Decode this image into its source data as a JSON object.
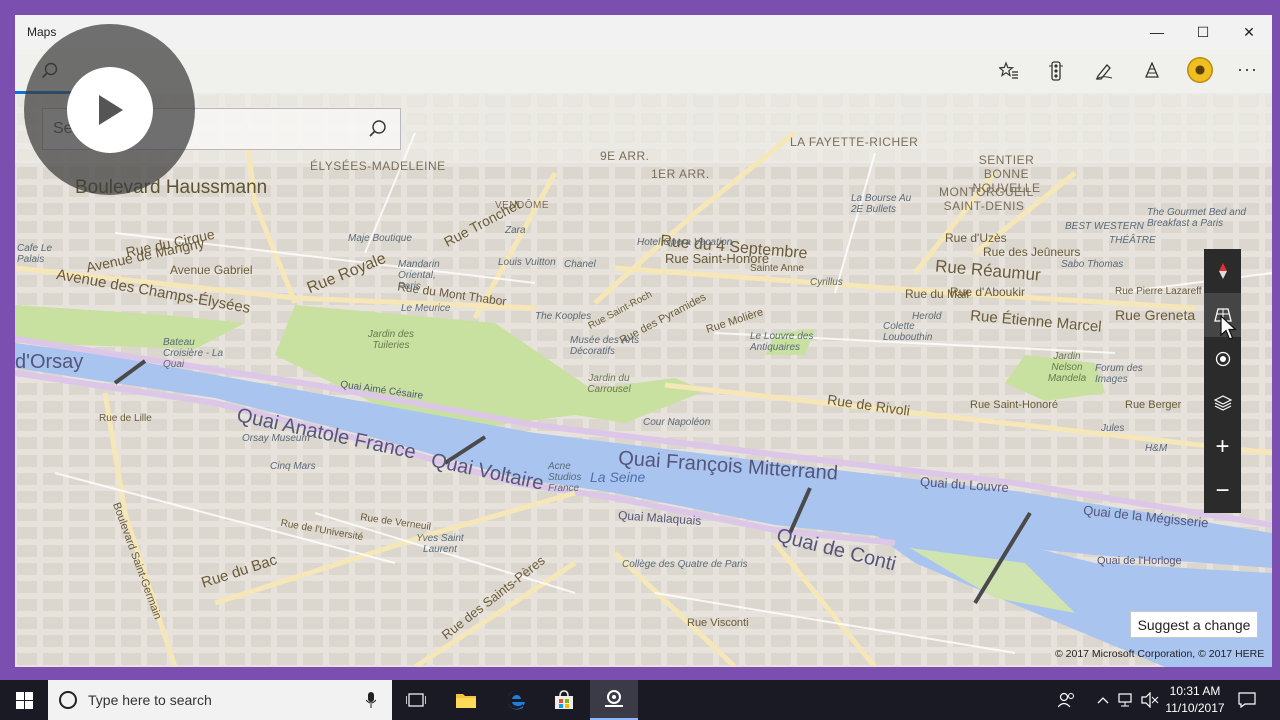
{
  "window": {
    "title": "Maps",
    "minimize": "—",
    "maximize": "☐",
    "close": "✕"
  },
  "search": {
    "placeholder": "Search"
  },
  "map": {
    "labels": {
      "haussmann": "Boulevard Haussmann",
      "elysees_madeleine": "ÉLYSÉES-MADELEINE",
      "arr9": "9E ARR.",
      "arr1": "1ER ARR.",
      "lafayette": "LA FAYETTE-RICHER",
      "sentier": "SENTIER BONNE NOUVELLE",
      "montorgueil": "MONTORGUEIL SAINT-DENIS",
      "vendome": "VENDÔME",
      "rue_du_cirque": "Rue du Cirque",
      "avenue_marigny": "Avenue de Marigny",
      "avenue_gabriel": "Avenue Gabriel",
      "champs": "Avenue des Champs-Élysées",
      "rue_royale": "Rue Royale",
      "rue_tronchet": "Rue Tronchet",
      "rue_4_sept": "Rue du 4 Septembre",
      "rue_st_honore": "Rue Saint-Honoré",
      "rue_st_honore_2": "Rue du Mont Thabor",
      "rue_reaumur": "Rue Réaumur",
      "rue_etienne": "Rue Étienne Marcel",
      "rue_grenata": "Rue Greneta",
      "rue_rivoli": "Rue de Rivoli",
      "rue_st_honore_3": "Rue Saint-Honoré",
      "rue_de_lille": "Rue de Lille",
      "rue_du_bac": "Rue du Bac",
      "rue_sts_peres": "Rue des Saints-Pères",
      "rue_visconti": "Rue Visconti",
      "rue_verneuil": "Rue de Verneuil",
      "rue_universite": "Rue de l'Université",
      "bd_st_germain": "Boulevard Saint-Germain",
      "rue_uzes": "Rue d'Uzès",
      "rue_jeuneurs": "Rue des Jeûneurs",
      "rue_mail": "Rue du Mail",
      "rue_aboukir": "Rue d'Aboukir",
      "rue_moliere": "Rue Molière",
      "rue_des_pyramides": "Rue des Pyramides",
      "rue_saint_roch": "Rue Saint-Roch",
      "quai_anatole": "Quai Anatole France",
      "quai_voltaire": "Quai Voltaire",
      "quai_mitterrand": "Quai François Mitterrand",
      "quai_conti": "Quai de Conti",
      "quai_louvre": "Quai du Louvre",
      "quai_megisserie": "Quai de la Mégisserie",
      "quai_malaquais": "Quai Malaquais",
      "quai_horloge": "Quai de l'Horloge",
      "quai_aime": "Quai Aimé Césaire",
      "quai_orsay": "d'Orsay",
      "la_seine": "La Seine",
      "jardin_tuileries": "Jardin des Tuileries",
      "jardin_carrousel": "Jardin du Carrousel",
      "cour_napoleon": "Cour Napoléon",
      "jardin_nelson": "Jardin Nelson Mandela",
      "orsay_museum": "Orsay Museum",
      "cinq_mars": "Cinq Mars",
      "yves_st_laurent": "Yves Saint Laurent",
      "acne": "Acne Studios France",
      "college": "Collège des Quatre de Paris",
      "bateau": "Bateau Croisière - La Quai",
      "kooples": "The Kooples",
      "arts_deco": "Musée des Arts Décoratifs",
      "louvre_antiquaires": "Le Louvre des Antiquaires",
      "forum_images": "Forum des Images",
      "sabo": "Sabo Thomas",
      "chanel": "Chanel",
      "vuitton": "Louis Vuitton",
      "zara": "Zara",
      "majestic": "Maje Boutique",
      "mandarin": "Mandarin Oriental, Paris",
      "le_meurice": "Le Meurice",
      "cyrillus": "Cyrillus",
      "colette": "Colette Loubouthin",
      "pierre_lazareff": "Rue Pierre Lazareff",
      "bourse": "La Bourse Au 2E Bullets",
      "gourmet": "The Gourmet Bed and Breakfast a Paris",
      "best_western": "BEST WESTERN",
      "theatre": "THÉÂTRE",
      "h_m": "H&M",
      "jules": "Jules",
      "rue_berger": "Rue Berger",
      "rue_sainte_anne": "Sainte Anne",
      "cafe_le_paris": "Cafe Le Palais",
      "le_quai": "La Quai",
      "hotel": "Hotel Opera Vacation",
      "herold": "Herold"
    }
  },
  "controls": {
    "compass": "compass-icon",
    "tilt": "tilt-icon",
    "locate": "locate-icon",
    "layers": "layers-icon",
    "zoom_in": "+",
    "zoom_out": "−"
  },
  "suggest": "Suggest a change",
  "copyright": "© 2017 Microsoft Corporation, © 2017 HERE",
  "taskbar": {
    "search_placeholder": "Type here to search",
    "time": "10:31 AM",
    "date": "11/10/2017"
  },
  "colors": {
    "accent": "#0a74d6",
    "desktop": "#7a4fb0",
    "water": "#a9c4ef",
    "park": "#c8e0a0",
    "road": "#f5e7b8",
    "quai": "#ddc7e8"
  }
}
